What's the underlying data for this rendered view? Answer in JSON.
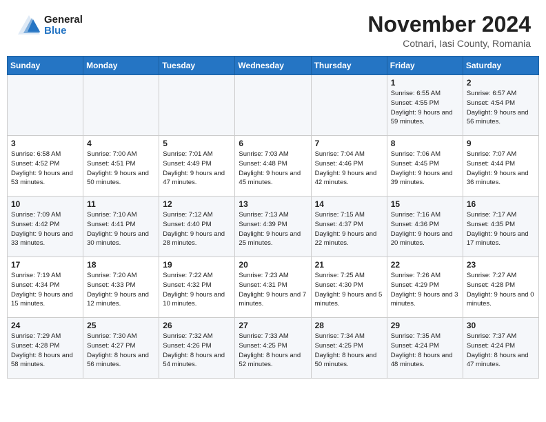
{
  "logo": {
    "general": "General",
    "blue": "Blue"
  },
  "title": {
    "month": "November 2024",
    "location": "Cotnari, Iasi County, Romania"
  },
  "weekdays": [
    "Sunday",
    "Monday",
    "Tuesday",
    "Wednesday",
    "Thursday",
    "Friday",
    "Saturday"
  ],
  "weeks": [
    [
      {
        "day": "",
        "detail": ""
      },
      {
        "day": "",
        "detail": ""
      },
      {
        "day": "",
        "detail": ""
      },
      {
        "day": "",
        "detail": ""
      },
      {
        "day": "",
        "detail": ""
      },
      {
        "day": "1",
        "detail": "Sunrise: 6:55 AM\nSunset: 4:55 PM\nDaylight: 9 hours\nand 59 minutes."
      },
      {
        "day": "2",
        "detail": "Sunrise: 6:57 AM\nSunset: 4:54 PM\nDaylight: 9 hours\nand 56 minutes."
      }
    ],
    [
      {
        "day": "3",
        "detail": "Sunrise: 6:58 AM\nSunset: 4:52 PM\nDaylight: 9 hours\nand 53 minutes."
      },
      {
        "day": "4",
        "detail": "Sunrise: 7:00 AM\nSunset: 4:51 PM\nDaylight: 9 hours\nand 50 minutes."
      },
      {
        "day": "5",
        "detail": "Sunrise: 7:01 AM\nSunset: 4:49 PM\nDaylight: 9 hours\nand 47 minutes."
      },
      {
        "day": "6",
        "detail": "Sunrise: 7:03 AM\nSunset: 4:48 PM\nDaylight: 9 hours\nand 45 minutes."
      },
      {
        "day": "7",
        "detail": "Sunrise: 7:04 AM\nSunset: 4:46 PM\nDaylight: 9 hours\nand 42 minutes."
      },
      {
        "day": "8",
        "detail": "Sunrise: 7:06 AM\nSunset: 4:45 PM\nDaylight: 9 hours\nand 39 minutes."
      },
      {
        "day": "9",
        "detail": "Sunrise: 7:07 AM\nSunset: 4:44 PM\nDaylight: 9 hours\nand 36 minutes."
      }
    ],
    [
      {
        "day": "10",
        "detail": "Sunrise: 7:09 AM\nSunset: 4:42 PM\nDaylight: 9 hours\nand 33 minutes."
      },
      {
        "day": "11",
        "detail": "Sunrise: 7:10 AM\nSunset: 4:41 PM\nDaylight: 9 hours\nand 30 minutes."
      },
      {
        "day": "12",
        "detail": "Sunrise: 7:12 AM\nSunset: 4:40 PM\nDaylight: 9 hours\nand 28 minutes."
      },
      {
        "day": "13",
        "detail": "Sunrise: 7:13 AM\nSunset: 4:39 PM\nDaylight: 9 hours\nand 25 minutes."
      },
      {
        "day": "14",
        "detail": "Sunrise: 7:15 AM\nSunset: 4:37 PM\nDaylight: 9 hours\nand 22 minutes."
      },
      {
        "day": "15",
        "detail": "Sunrise: 7:16 AM\nSunset: 4:36 PM\nDaylight: 9 hours\nand 20 minutes."
      },
      {
        "day": "16",
        "detail": "Sunrise: 7:17 AM\nSunset: 4:35 PM\nDaylight: 9 hours\nand 17 minutes."
      }
    ],
    [
      {
        "day": "17",
        "detail": "Sunrise: 7:19 AM\nSunset: 4:34 PM\nDaylight: 9 hours\nand 15 minutes."
      },
      {
        "day": "18",
        "detail": "Sunrise: 7:20 AM\nSunset: 4:33 PM\nDaylight: 9 hours\nand 12 minutes."
      },
      {
        "day": "19",
        "detail": "Sunrise: 7:22 AM\nSunset: 4:32 PM\nDaylight: 9 hours\nand 10 minutes."
      },
      {
        "day": "20",
        "detail": "Sunrise: 7:23 AM\nSunset: 4:31 PM\nDaylight: 9 hours\nand 7 minutes."
      },
      {
        "day": "21",
        "detail": "Sunrise: 7:25 AM\nSunset: 4:30 PM\nDaylight: 9 hours\nand 5 minutes."
      },
      {
        "day": "22",
        "detail": "Sunrise: 7:26 AM\nSunset: 4:29 PM\nDaylight: 9 hours\nand 3 minutes."
      },
      {
        "day": "23",
        "detail": "Sunrise: 7:27 AM\nSunset: 4:28 PM\nDaylight: 9 hours\nand 0 minutes."
      }
    ],
    [
      {
        "day": "24",
        "detail": "Sunrise: 7:29 AM\nSunset: 4:28 PM\nDaylight: 8 hours\nand 58 minutes."
      },
      {
        "day": "25",
        "detail": "Sunrise: 7:30 AM\nSunset: 4:27 PM\nDaylight: 8 hours\nand 56 minutes."
      },
      {
        "day": "26",
        "detail": "Sunrise: 7:32 AM\nSunset: 4:26 PM\nDaylight: 8 hours\nand 54 minutes."
      },
      {
        "day": "27",
        "detail": "Sunrise: 7:33 AM\nSunset: 4:25 PM\nDaylight: 8 hours\nand 52 minutes."
      },
      {
        "day": "28",
        "detail": "Sunrise: 7:34 AM\nSunset: 4:25 PM\nDaylight: 8 hours\nand 50 minutes."
      },
      {
        "day": "29",
        "detail": "Sunrise: 7:35 AM\nSunset: 4:24 PM\nDaylight: 8 hours\nand 48 minutes."
      },
      {
        "day": "30",
        "detail": "Sunrise: 7:37 AM\nSunset: 4:24 PM\nDaylight: 8 hours\nand 47 minutes."
      }
    ]
  ]
}
